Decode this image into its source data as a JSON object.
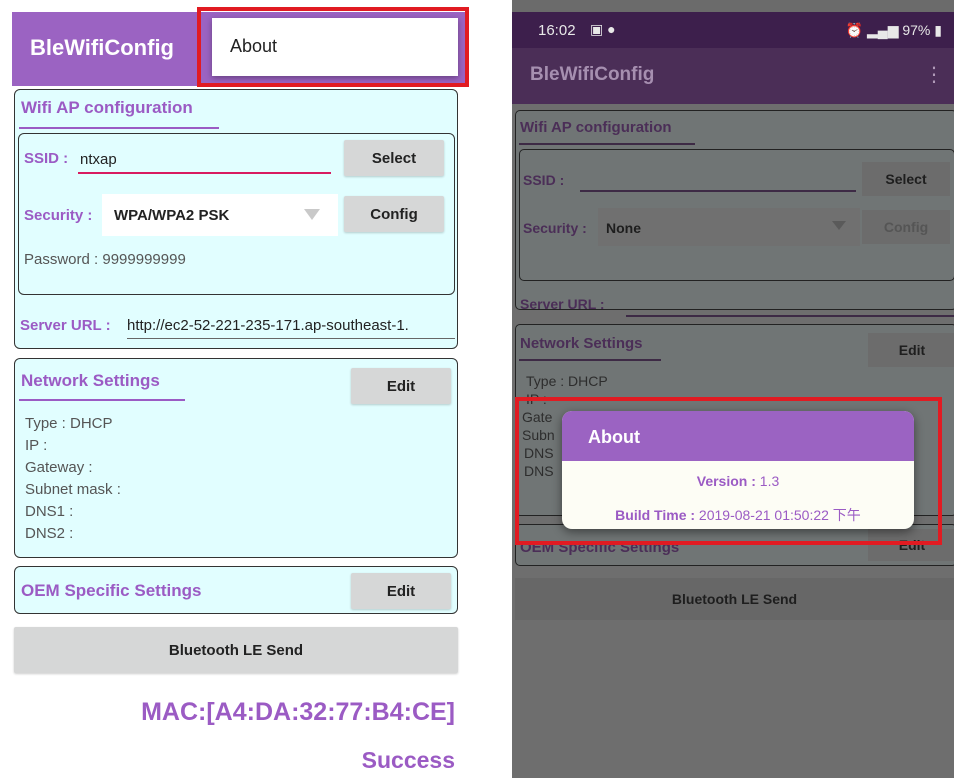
{
  "left": {
    "app_title": "BleWifiConfig",
    "menu": {
      "about_label": "About"
    },
    "wifi": {
      "section_title": "Wifi AP configuration",
      "ssid_label": "SSID :",
      "ssid_value": "ntxap",
      "select_label": "Select",
      "security_label": "Security :",
      "security_value": "WPA/WPA2 PSK",
      "config_label": "Config",
      "password_text": "Password : 9999999999",
      "server_url_label": "Server URL :",
      "server_url_value": "http://ec2-52-221-235-171.ap-southeast-1."
    },
    "network": {
      "section_title": "Network Settings",
      "edit_label": "Edit",
      "lines": [
        "Type : DHCP",
        "IP :",
        "Gateway :",
        "Subnet mask :",
        "DNS1 :",
        "DNS2 :"
      ]
    },
    "oem": {
      "section_title": "OEM Specific Settings",
      "edit_label": "Edit"
    },
    "send_label": "Bluetooth LE Send",
    "mac_text": "MAC:[A4:DA:32:77:B4:CE]",
    "status_text": "Success"
  },
  "right": {
    "status": {
      "time": "16:02",
      "right_text": "97%"
    },
    "app_title": "BleWifiConfig",
    "wifi": {
      "section_title": "Wifi AP configuration",
      "ssid_label": "SSID :",
      "select_label": "Select",
      "security_label": "Security :",
      "security_value": "None",
      "config_label": "Config",
      "server_url_label": "Server URL :"
    },
    "network": {
      "section_title": "Network Settings",
      "edit_label": "Edit",
      "line1": "Type : DHCP",
      "fragments": [
        "IP :",
        "Gate",
        "Subn",
        "DNS",
        "DNS"
      ]
    },
    "oem": {
      "section_title": "OEM Specific Settings",
      "edit_label": "Edit"
    },
    "send_label": "Bluetooth LE Send",
    "dialog": {
      "title": "About",
      "version_label": "Version :",
      "version_value": "1.3",
      "build_label": "Build Time :",
      "build_value": "2019-08-21 01:50:22 下午"
    }
  },
  "colors": {
    "accent": "#9b63c2",
    "highlight": "#e11b22",
    "section_bg": "#e1feff"
  },
  "icons": [
    "dropdown-arrow-icon",
    "gallery-icon",
    "chat-icon",
    "alarm-icon",
    "signal-icon",
    "battery-icon",
    "overflow-menu-icon"
  ]
}
